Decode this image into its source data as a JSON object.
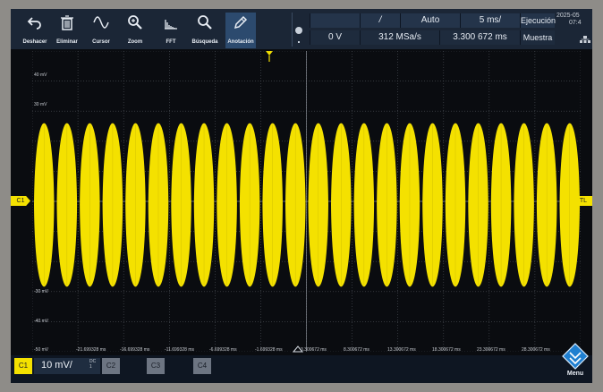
{
  "toolbar": {
    "tools": [
      {
        "label": "Deshacer",
        "icon": "undo-icon"
      },
      {
        "label": "Eliminar",
        "icon": "trash-icon"
      },
      {
        "label": "Cursor",
        "icon": "cursor-wave-icon"
      },
      {
        "label": "Zoom",
        "icon": "zoom-icon"
      },
      {
        "label": "FFT",
        "icon": "fft-icon"
      },
      {
        "label": "Búsqueda",
        "icon": "search-icon"
      },
      {
        "label": "Anotación",
        "icon": "pen-icon"
      }
    ]
  },
  "status": {
    "trigger_source": "C1",
    "trigger_slope_symbol": "/",
    "trigger_level": "0 V",
    "trigger_mode": "Auto",
    "sample_rate": "312 MSa/s",
    "time_scale": "5 ms/",
    "horizontal_position": "3.300 672 ms",
    "run_state": "Ejecución",
    "acquisition_mode": "Muestra",
    "date": "2025-05",
    "time": "07:4"
  },
  "graticule": {
    "y_labels": [
      "40 mV",
      "30 mV",
      "-30 mV",
      "-40 mV",
      "-50 mV"
    ],
    "x_labels": [
      "-21.699328 ms",
      "-16.699328 ms",
      "-11.699328 ms",
      "-6.699328 ms",
      "-1.699328 ms",
      "3.300672 ms",
      "8.300672 ms",
      "13.300672 ms",
      "18.300672 ms",
      "23.300672 ms",
      "28.300672 ms"
    ],
    "ch1_marker": "C1",
    "trigger_level_marker": "TL",
    "waveform_color": "#f4e100",
    "grid_color": "#5a5f66"
  },
  "waveform": {
    "cycles": 24,
    "amplitude_mV": 29
  },
  "bottombar": {
    "ch1_label": "C1",
    "ch1_scale": "10 mV/",
    "ch1_coupling": "DC",
    "ch1_extra": "1",
    "ch2_label": "C2",
    "ch3_label": "C3",
    "ch4_label": "C4",
    "menu_label": "Menu"
  }
}
